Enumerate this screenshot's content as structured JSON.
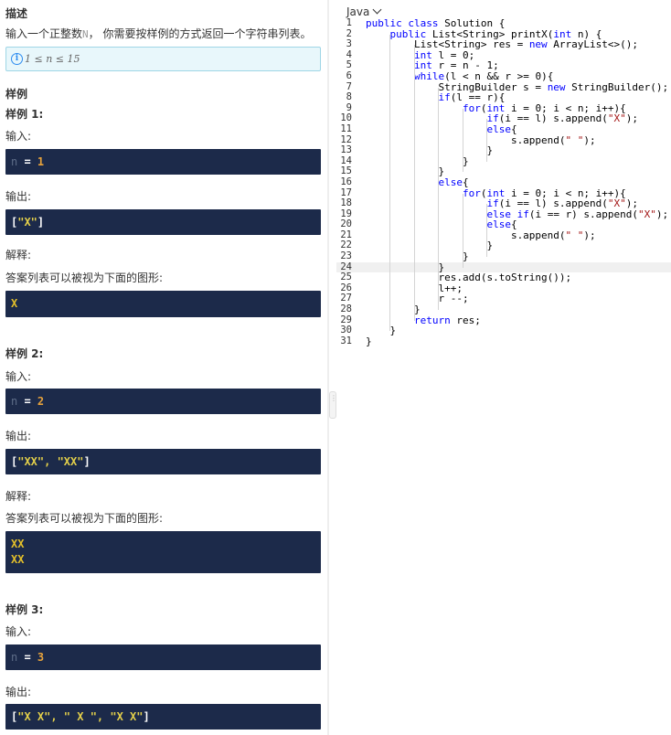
{
  "problem": {
    "desc_heading": "描述",
    "desc_pre": "输入一个正整数",
    "desc_var": "N",
    "desc_post": "， 你需要按样例的方式返回一个字符串列表。",
    "constraint": "1 ≤ n ≤ 15",
    "samples_heading": "样例"
  },
  "samples": [
    {
      "title": "样例 1:",
      "input_label": "输入:",
      "input_var": "n",
      "input_eq": " = ",
      "input_value": "1",
      "output_label": "输出:",
      "output_open": "[",
      "output_items": "\"X\"",
      "output_close": "]",
      "explain_label": "解释:",
      "explain_text": "答案列表可以被视为下面的图形:",
      "figure": [
        "X"
      ]
    },
    {
      "title": "样例 2:",
      "input_label": "输入:",
      "input_var": "n",
      "input_eq": " = ",
      "input_value": "2",
      "output_label": "输出:",
      "output_open": "[",
      "output_items": "\"XX\", \"XX\"",
      "output_close": "]",
      "explain_label": "解释:",
      "explain_text": "答案列表可以被视为下面的图形:",
      "figure": [
        "XX",
        "XX"
      ]
    },
    {
      "title": "样例 3:",
      "input_label": "输入:",
      "input_var": "n",
      "input_eq": " = ",
      "input_value": "3",
      "output_label": "输出:",
      "output_open": "[",
      "output_items": "\"X X\", \" X \", \"X X\"",
      "output_close": "]"
    }
  ],
  "editor": {
    "language": "Java",
    "line_numbers": [
      "1",
      "2",
      "3",
      "4",
      "5",
      "6",
      "7",
      "8",
      "9",
      "10",
      "11",
      "12",
      "13",
      "14",
      "15",
      "16",
      "17",
      "18",
      "19",
      "20",
      "21",
      "22",
      "23",
      "24",
      "25",
      "26",
      "27",
      "28",
      "29",
      "30",
      "31"
    ],
    "lines": [
      "public class Solution {",
      "    public List<String> printX(int n) {",
      "        List<String> res = new ArrayList<>();",
      "        int l = 0;",
      "        int r = n - 1;",
      "        while(l < n && r >= 0){",
      "            StringBuilder s = new StringBuilder();",
      "            if(l == r){",
      "                for(int i = 0; i < n; i++){",
      "                    if(i == l) s.append(\"X\");",
      "                    else{",
      "                        s.append(\" \");",
      "                    }",
      "                }",
      "            }",
      "            else{",
      "                for(int i = 0; i < n; i++){",
      "                    if(i == l) s.append(\"X\");",
      "                    else if(i == r) s.append(\"X\");",
      "                    else{",
      "                        s.append(\" \");",
      "                    }",
      "                }",
      "            }",
      "            res.add(s.toString());",
      "            l++;",
      "            r --;",
      "        }",
      "        return res;",
      "    }",
      "}"
    ]
  },
  "colors": {
    "dark_block": "#1c2a4a",
    "number": "#e6a23c",
    "string": "#e5d14a",
    "info": "#2d8cf0",
    "keyword": "#0000ff",
    "code_string": "#a31515"
  }
}
